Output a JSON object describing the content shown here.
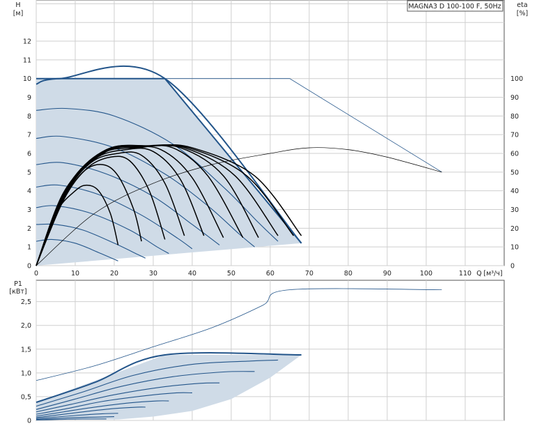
{
  "title": "MAGNA3 D 100-100 F, 50Hz",
  "colors": {
    "grid": "#cfcfcf",
    "axis": "#555555",
    "envelope_fill": "#cfdbe7",
    "curve_blue": "#23558a",
    "curve_black": "#000000"
  },
  "chart_data": [
    {
      "type": "line",
      "name": "head-chart",
      "ylabel": "H",
      "yunit": "[м]",
      "y2label": "eta",
      "y2unit": "[%]",
      "xlabel": "Q",
      "xunit": "[м³/ч]",
      "xlim": [
        0,
        120
      ],
      "ylim": [
        0,
        14.2
      ],
      "y2lim": [
        0,
        142
      ],
      "x_ticks": [
        0,
        10,
        20,
        30,
        40,
        50,
        60,
        70,
        80,
        90,
        100,
        110
      ],
      "y_ticks": [
        0,
        1,
        2,
        3,
        4,
        5,
        6,
        7,
        8,
        9,
        10,
        11,
        12
      ],
      "y2_ticks": [
        0,
        10,
        20,
        30,
        40,
        50,
        60,
        70,
        80,
        90,
        100
      ],
      "envelope": [
        [
          0,
          0
        ],
        [
          0,
          10
        ],
        [
          33,
          10
        ],
        [
          68,
          1.2
        ],
        [
          0,
          0
        ]
      ],
      "speed_curves": [
        [
          [
            0,
            9.7
          ],
          [
            6,
            10
          ],
          [
            33,
            10
          ],
          [
            68,
            1.2
          ]
        ],
        [
          [
            0,
            8.3
          ],
          [
            8,
            8.4
          ],
          [
            20,
            8.0
          ],
          [
            35,
            6.5
          ],
          [
            48,
            4.2
          ],
          [
            57,
            2.3
          ],
          [
            62,
            1.3
          ]
        ],
        [
          [
            0,
            6.8
          ],
          [
            7,
            6.9
          ],
          [
            20,
            6.3
          ],
          [
            33,
            4.9
          ],
          [
            44,
            3.2
          ],
          [
            52,
            1.7
          ],
          [
            56,
            1.0
          ]
        ],
        [
          [
            0,
            5.4
          ],
          [
            7,
            5.5
          ],
          [
            18,
            4.9
          ],
          [
            30,
            3.7
          ],
          [
            40,
            2.2
          ],
          [
            47,
            1.1
          ]
        ],
        [
          [
            0,
            4.2
          ],
          [
            6,
            4.3
          ],
          [
            16,
            3.8
          ],
          [
            27,
            2.7
          ],
          [
            36,
            1.5
          ],
          [
            40,
            0.9
          ]
        ],
        [
          [
            0,
            3.1
          ],
          [
            5,
            3.2
          ],
          [
            14,
            2.8
          ],
          [
            24,
            1.9
          ],
          [
            31,
            1.0
          ],
          [
            34,
            0.65
          ]
        ],
        [
          [
            0,
            2.2
          ],
          [
            5,
            2.2
          ],
          [
            12,
            1.9
          ],
          [
            20,
            1.2
          ],
          [
            26,
            0.6
          ],
          [
            28,
            0.4
          ]
        ],
        [
          [
            0,
            1.3
          ],
          [
            4,
            1.4
          ],
          [
            10,
            1.2
          ],
          [
            16,
            0.7
          ],
          [
            21,
            0.25
          ]
        ]
      ],
      "max_curve": [
        [
          0,
          10
        ],
        [
          65,
          10
        ],
        [
          104,
          5.0
        ]
      ],
      "eta_curves_black": [
        [
          [
            0,
            0
          ],
          [
            5,
            28
          ],
          [
            10,
            40
          ],
          [
            13,
            43
          ],
          [
            16,
            40
          ],
          [
            19,
            28
          ],
          [
            21,
            11
          ]
        ],
        [
          [
            0,
            0
          ],
          [
            6,
            32
          ],
          [
            12,
            50
          ],
          [
            17,
            54
          ],
          [
            21,
            48
          ],
          [
            25,
            30
          ],
          [
            27,
            13
          ]
        ],
        [
          [
            0,
            0
          ],
          [
            7,
            35
          ],
          [
            13,
            52
          ],
          [
            19,
            58
          ],
          [
            24,
            56
          ],
          [
            29,
            40
          ],
          [
            33,
            14
          ]
        ],
        [
          [
            0,
            0
          ],
          [
            7,
            37
          ],
          [
            14,
            55
          ],
          [
            21,
            60
          ],
          [
            27,
            59
          ],
          [
            33,
            44
          ],
          [
            38,
            16
          ]
        ],
        [
          [
            0,
            0
          ],
          [
            7,
            38
          ],
          [
            15,
            57
          ],
          [
            23,
            62
          ],
          [
            30,
            61
          ],
          [
            37,
            46
          ],
          [
            43,
            16
          ]
        ],
        [
          [
            0,
            0
          ],
          [
            7,
            39
          ],
          [
            16,
            59
          ],
          [
            24,
            63
          ],
          [
            32,
            62
          ],
          [
            40,
            47
          ],
          [
            48,
            15
          ]
        ],
        [
          [
            0,
            0
          ],
          [
            8,
            40
          ],
          [
            17,
            60
          ],
          [
            26,
            63
          ],
          [
            35,
            63
          ],
          [
            44,
            48
          ],
          [
            53,
            15
          ]
        ],
        [
          [
            0,
            0
          ],
          [
            8,
            41
          ],
          [
            18,
            61
          ],
          [
            27,
            63.5
          ],
          [
            37,
            63
          ],
          [
            48,
            48
          ],
          [
            57,
            15
          ]
        ],
        [
          [
            0,
            0
          ],
          [
            8,
            42
          ],
          [
            18,
            61.5
          ],
          [
            28,
            64
          ],
          [
            38,
            63
          ],
          [
            51,
            48
          ],
          [
            62,
            16
          ]
        ],
        [
          [
            0,
            0
          ],
          [
            8,
            42
          ],
          [
            18,
            62
          ],
          [
            29,
            64
          ],
          [
            39,
            63
          ],
          [
            54,
            48
          ],
          [
            66,
            16
          ]
        ],
        [
          [
            0,
            0
          ],
          [
            8,
            42
          ],
          [
            18,
            62
          ],
          [
            30,
            64
          ],
          [
            40,
            63
          ],
          [
            56,
            48
          ],
          [
            68,
            16
          ]
        ]
      ],
      "eta_curve_thin": [
        [
          0,
          0
        ],
        [
          15,
          28
        ],
        [
          30,
          44
        ],
        [
          45,
          54
        ],
        [
          60,
          60
        ],
        [
          70,
          63
        ],
        [
          80,
          62
        ],
        [
          90,
          58
        ],
        [
          104,
          50
        ]
      ]
    },
    {
      "type": "line",
      "name": "power-chart",
      "ylabel": "P1",
      "yunit": "[кВт]",
      "xlim": [
        0,
        120
      ],
      "ylim": [
        0,
        2.95
      ],
      "y_ticks": [
        "0",
        "0,5",
        "1,0",
        "1,5",
        "2,0",
        "2,5"
      ],
      "y_tick_values": [
        0,
        0.5,
        1.0,
        1.5,
        2.0,
        2.5
      ],
      "envelope": [
        [
          0,
          0.02
        ],
        [
          0,
          0.38
        ],
        [
          33,
          1.38
        ],
        [
          68,
          1.38
        ],
        [
          60,
          0.9
        ],
        [
          50,
          0.45
        ],
        [
          40,
          0.2
        ],
        [
          30,
          0.08
        ],
        [
          21,
          0.02
        ],
        [
          0,
          0.02
        ]
      ],
      "speed_curves": [
        [
          [
            0,
            0.38
          ],
          [
            15,
            0.8
          ],
          [
            33,
            1.38
          ],
          [
            68,
            1.38
          ]
        ],
        [
          [
            0,
            0.3
          ],
          [
            12,
            0.6
          ],
          [
            25,
            0.95
          ],
          [
            40,
            1.18
          ],
          [
            55,
            1.25
          ],
          [
            62,
            1.27
          ]
        ],
        [
          [
            0,
            0.23
          ],
          [
            10,
            0.45
          ],
          [
            22,
            0.72
          ],
          [
            35,
            0.92
          ],
          [
            48,
            1.02
          ],
          [
            56,
            1.03
          ]
        ],
        [
          [
            0,
            0.18
          ],
          [
            9,
            0.34
          ],
          [
            20,
            0.54
          ],
          [
            32,
            0.7
          ],
          [
            42,
            0.78
          ],
          [
            47,
            0.79
          ]
        ],
        [
          [
            0,
            0.13
          ],
          [
            8,
            0.25
          ],
          [
            17,
            0.4
          ],
          [
            28,
            0.52
          ],
          [
            36,
            0.58
          ],
          [
            40,
            0.58
          ]
        ],
        [
          [
            0,
            0.09
          ],
          [
            7,
            0.18
          ],
          [
            15,
            0.28
          ],
          [
            24,
            0.37
          ],
          [
            31,
            0.41
          ],
          [
            34,
            0.41
          ]
        ],
        [
          [
            0,
            0.06
          ],
          [
            6,
            0.12
          ],
          [
            13,
            0.19
          ],
          [
            20,
            0.25
          ],
          [
            26,
            0.28
          ],
          [
            28,
            0.28
          ]
        ],
        [
          [
            0,
            0.04
          ],
          [
            5,
            0.07
          ],
          [
            11,
            0.11
          ],
          [
            17,
            0.14
          ],
          [
            21,
            0.15
          ]
        ],
        [
          [
            0,
            0.02
          ],
          [
            5,
            0.04
          ],
          [
            10,
            0.06
          ],
          [
            16,
            0.07
          ],
          [
            20,
            0.08
          ]
        ],
        [
          [
            0,
            0.01
          ],
          [
            6,
            0.02
          ],
          [
            12,
            0.03
          ],
          [
            18,
            0.03
          ]
        ]
      ],
      "max_curve": [
        [
          0,
          0.84
        ],
        [
          15,
          1.15
        ],
        [
          30,
          1.55
        ],
        [
          45,
          1.95
        ],
        [
          58,
          2.42
        ],
        [
          65,
          2.75
        ],
        [
          104,
          2.75
        ]
      ]
    }
  ]
}
